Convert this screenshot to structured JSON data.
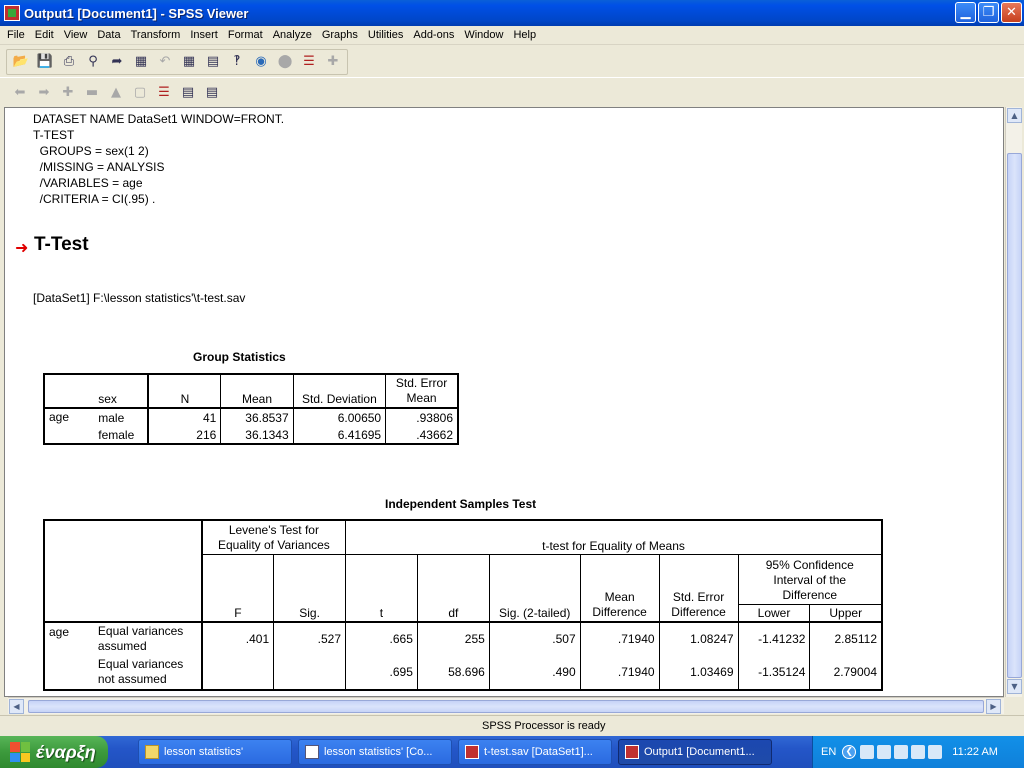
{
  "window": {
    "title": "Output1 [Document1] - SPSS Viewer",
    "minimize_glyph": "▁",
    "maximize_glyph": "❐",
    "close_glyph": "✕"
  },
  "menu": [
    "File",
    "Edit",
    "View",
    "Data",
    "Transform",
    "Insert",
    "Format",
    "Analyze",
    "Graphs",
    "Utilities",
    "Add-ons",
    "Window",
    "Help"
  ],
  "syntax": {
    "lines": [
      "DATASET NAME DataSet1 WINDOW=FRONT.",
      "T-TEST",
      "  GROUPS = sex(1 2)",
      "  /MISSING = ANALYSIS",
      "  /VARIABLES = age",
      "  /CRITERIA = CI(.95) ."
    ]
  },
  "ttest_heading": "T-Test",
  "dataset_line": "[DataSet1] F:\\lesson statistics'\\t-test.sav",
  "group_stats": {
    "title": "Group Statistics",
    "headers": {
      "sex": "sex",
      "n": "N",
      "mean": "Mean",
      "sd": "Std. Deviation",
      "se_line1": "Std. Error",
      "se_line2": "Mean"
    },
    "variable": "age",
    "rows": [
      {
        "group": "male",
        "n": "41",
        "mean": "36.8537",
        "sd": "6.00650",
        "se": ".93806"
      },
      {
        "group": "female",
        "n": "216",
        "mean": "36.1343",
        "sd": "6.41695",
        "se": ".43662"
      }
    ]
  },
  "ind_test": {
    "title": "Independent Samples Test",
    "levene_line1": "Levene's Test for",
    "levene_line2": "Equality of Variances",
    "ttest_header": "t-test for Equality of Means",
    "ci_line1": "95% Confidence",
    "ci_line2": "Interval of the",
    "ci_line3": "Difference",
    "cols": {
      "f": "F",
      "sig": "Sig.",
      "t": "t",
      "df": "df",
      "sig2": "Sig. (2-tailed)",
      "md1": "Mean",
      "md2": "Difference",
      "sed1": "Std. Error",
      "sed2": "Difference",
      "lower": "Lower",
      "upper": "Upper"
    },
    "variable": "age",
    "rows": [
      {
        "label1": "Equal variances",
        "label2": "assumed",
        "f": ".401",
        "sig": ".527",
        "t": ".665",
        "df": "255",
        "sig2": ".507",
        "md": ".71940",
        "sed": "1.08247",
        "lower": "-1.41232",
        "upper": "2.85112"
      },
      {
        "label1": "Equal variances",
        "label2": "not assumed",
        "f": "",
        "sig": "",
        "t": ".695",
        "df": "58.696",
        "sig2": ".490",
        "md": ".71940",
        "sed": "1.03469",
        "lower": "-1.35124",
        "upper": "2.79004"
      }
    ]
  },
  "status": "SPSS Processor is ready",
  "taskbar": {
    "start": "έναρξη",
    "tasks": [
      {
        "label": "lesson statistics'",
        "icon": "folder"
      },
      {
        "label": "lesson statistics' [Co...",
        "icon": "doc"
      },
      {
        "label": "t-test.sav [DataSet1]...",
        "icon": "spss"
      },
      {
        "label": "Output1 [Document1...",
        "icon": "spss"
      }
    ],
    "lang": "EN",
    "clock": "11:22 AM"
  }
}
